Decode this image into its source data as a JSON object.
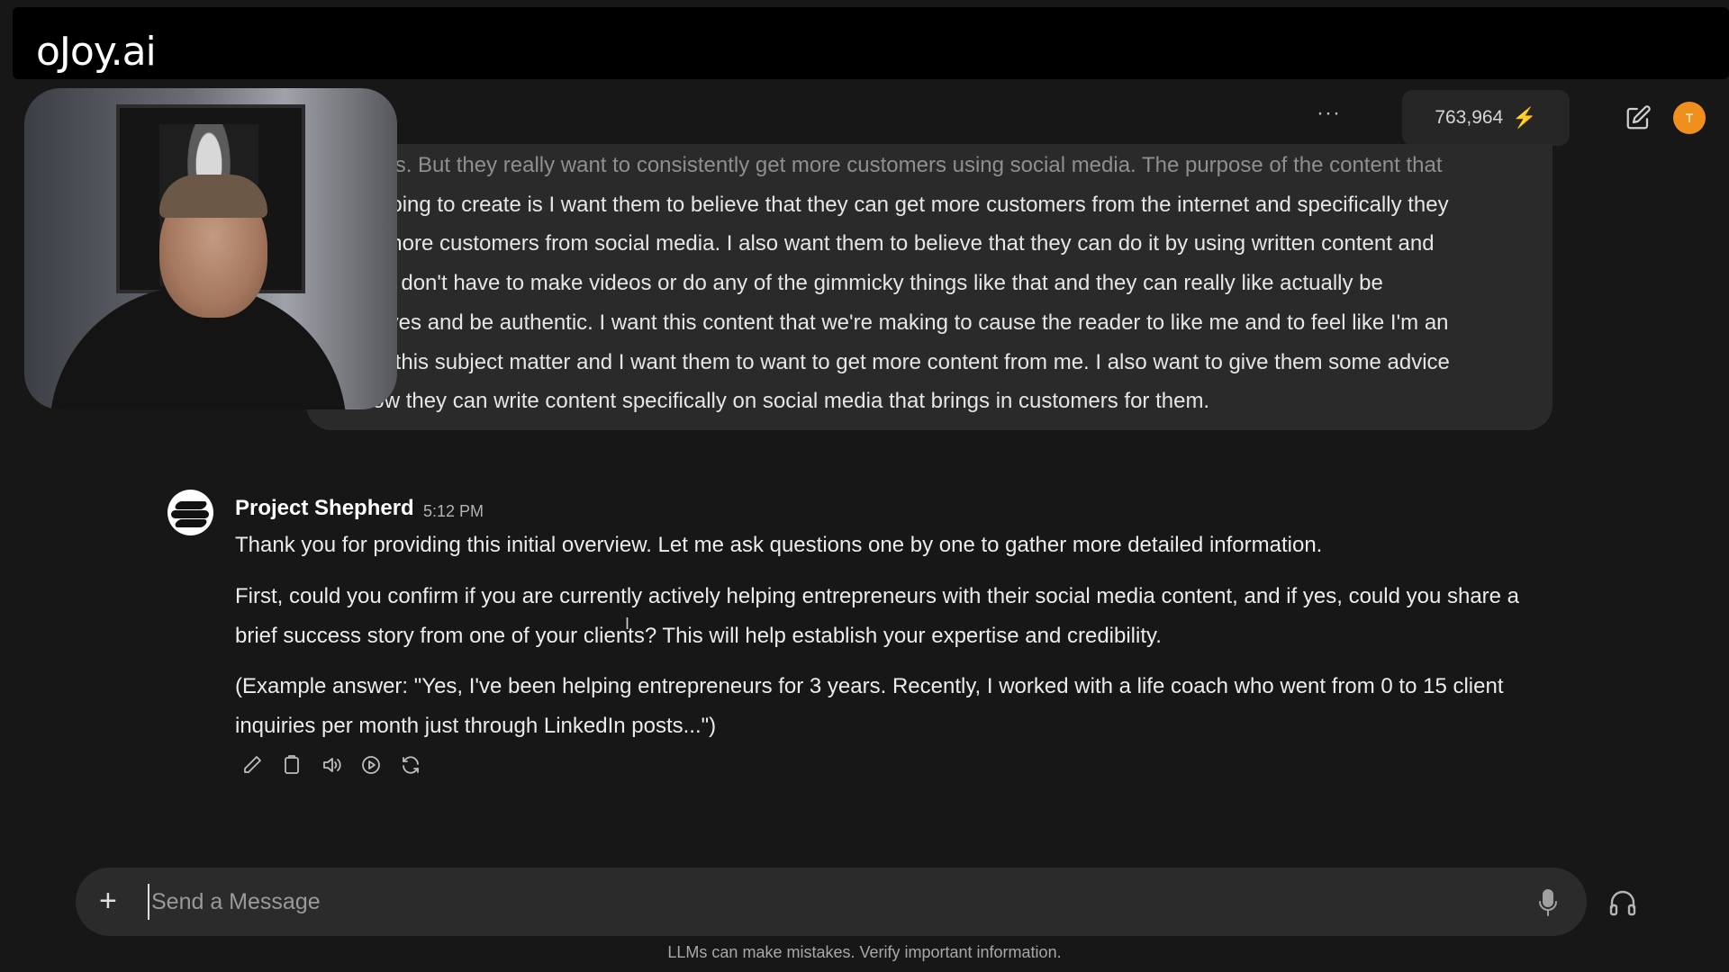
{
  "app": {
    "logo_text": "oJoy.ai"
  },
  "header": {
    "more_label": "···",
    "credits_value": "763,964",
    "credits_icon": "⚡",
    "avatar_initial": "T"
  },
  "user_message": {
    "lines": [
      "tools. But they really want to consistently get more customers using social media. The purpose of the content that",
      "e going to create is I want them to believe that they can get more customers from the internet and specifically they",
      "et more customers from social media. I also want them to believe that they can do it by using written content and",
      "hey don't have to make videos or do any of the gimmicky things like that and they can really like actually be",
      "selves and be authentic. I want this content that we're making to cause the reader to like me and to feel like I'm an",
      "t in this subject matter and I want them to want to get more content from me. I also want to give them some advice",
      "how they can write content specifically on social media that brings in customers for them."
    ]
  },
  "bot_message": {
    "name": "Project Shepherd",
    "time": "5:12 PM",
    "paragraphs": [
      "Thank you for providing this initial overview. Let me ask questions one by one to gather more detailed information.",
      "First, could you confirm if you are currently actively helping entrepreneurs with their social media content, and if yes, could you share a brief success story from one of your clients? This will help establish your expertise and credibility.",
      "(Example answer: \"Yes, I've been helping entrepreneurs for 3 years. Recently, I worked with a life coach who went from 0 to 15 client inquiries per month just through LinkedIn posts...\")"
    ]
  },
  "composer": {
    "plus_label": "+",
    "placeholder": "Send a Message"
  },
  "footer": {
    "disclaimer": "LLMs can make mistakes. Verify important information."
  },
  "colors": {
    "accent_avatar": "#f0901c",
    "bolt": "#f5b10a"
  }
}
